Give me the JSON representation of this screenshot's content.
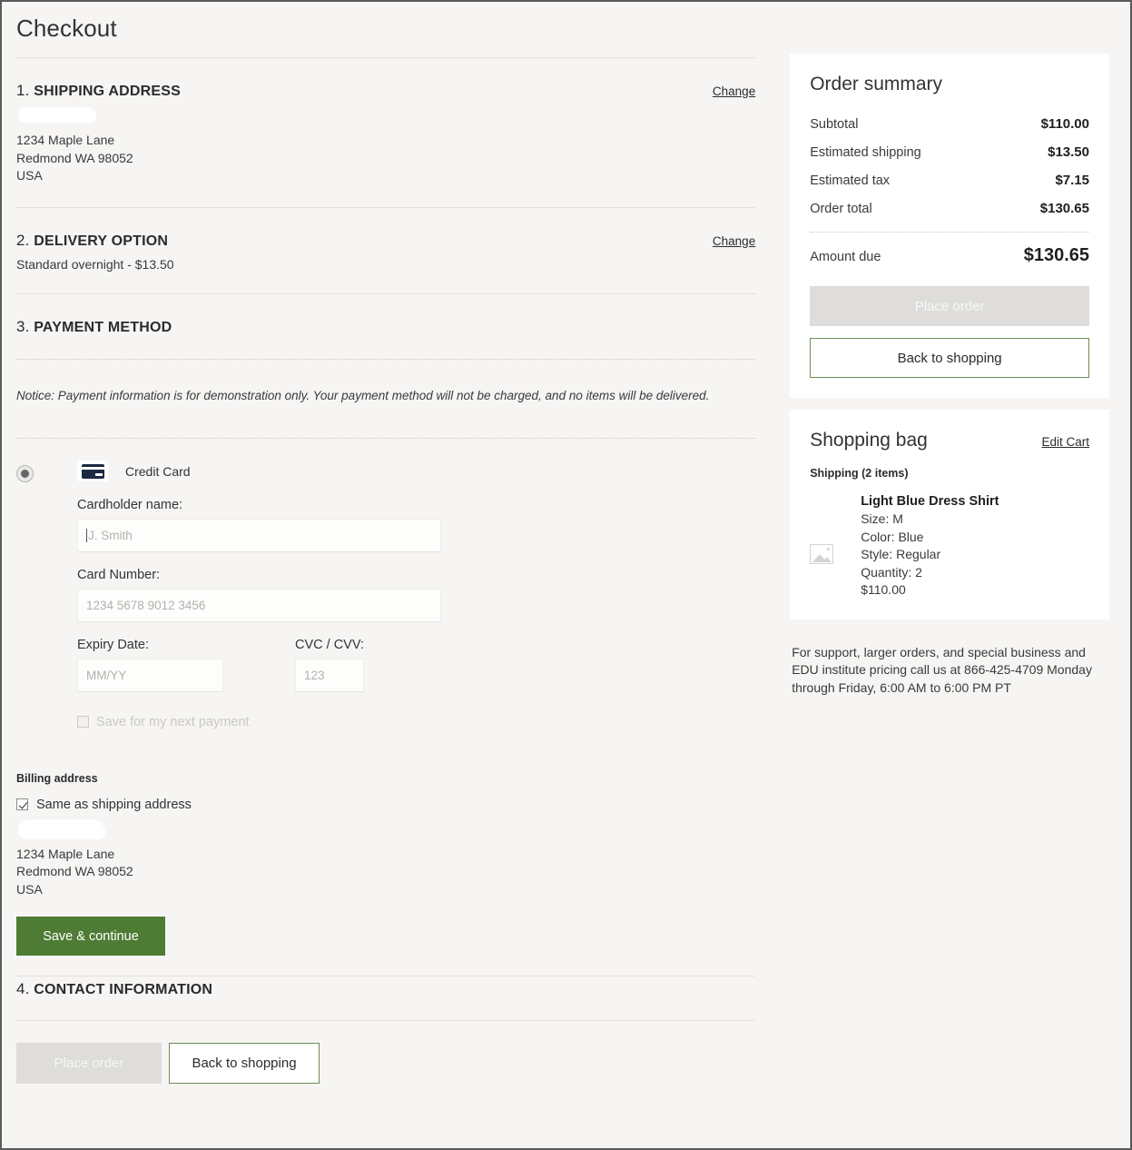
{
  "page": {
    "title": "Checkout"
  },
  "sections": {
    "shipping": {
      "number": "1.",
      "title": "SHIPPING ADDRESS",
      "change_label": "Change",
      "address_line1": "1234 Maple Lane",
      "address_line2": "Redmond WA 98052",
      "address_line3": "USA"
    },
    "delivery": {
      "number": "2.",
      "title": "DELIVERY OPTION",
      "change_label": "Change",
      "option": "Standard overnight -  $13.50"
    },
    "payment": {
      "number": "3.",
      "title": "PAYMENT METHOD",
      "notice": "Notice: Payment information is for demonstration only.  Your payment method will not be charged, and no items will be delivered.",
      "method_name": "Credit Card",
      "cardholder_label": "Cardholder name:",
      "cardholder_placeholder": "J. Smith",
      "cardholder_value": "",
      "cardnumber_label": "Card Number:",
      "cardnumber_placeholder": "1234 5678 9012 3456",
      "cardnumber_value": "",
      "expiry_label": "Expiry Date:",
      "expiry_placeholder": "MM/YY",
      "expiry_value": "",
      "cvc_label": "CVC / CVV:",
      "cvc_placeholder": "123",
      "cvc_value": "",
      "save_payment_label": "Save for my next payment",
      "billing_heading": "Billing address",
      "billing_same_label": "Same as shipping address",
      "billing_line1": "1234 Maple Lane",
      "billing_line2": "Redmond WA 98052",
      "billing_line3": "USA",
      "save_continue_label": "Save & continue"
    },
    "contact": {
      "number": "4.",
      "title": "CONTACT INFORMATION"
    }
  },
  "footer": {
    "place_order_label": "Place order",
    "back_to_shopping_label": "Back to shopping"
  },
  "order_summary": {
    "title": "Order summary",
    "rows": [
      {
        "label": "Subtotal",
        "value": "$110.00"
      },
      {
        "label": "Estimated shipping",
        "value": "$13.50"
      },
      {
        "label": "Estimated tax",
        "value": "$7.15"
      },
      {
        "label": "Order total",
        "value": "$130.65"
      }
    ],
    "amount_due_label": "Amount due",
    "amount_due_value": "$130.65",
    "place_order_label": "Place order",
    "back_to_shopping_label": "Back to shopping"
  },
  "shopping_bag": {
    "title": "Shopping bag",
    "edit_cart_label": "Edit Cart",
    "shipping_count_label": "Shipping (2 items)",
    "items": [
      {
        "name": "Light Blue Dress Shirt",
        "size": "Size: M",
        "color": "Color: Blue",
        "style": "Style: Regular",
        "quantity": "Quantity: 2",
        "price": "$110.00"
      }
    ],
    "support_text": "For support, larger orders, and special business and EDU institute pricing call us at 866-425-4709 Monday through Friday, 6:00 AM to 6:00 PM PT"
  },
  "colors": {
    "page_bg": "#f6f5f3",
    "card_bg": "#ffffff",
    "accent_green": "#4e7c35",
    "outline_green": "#6d8c56",
    "disabled_gray": "#dedddb"
  }
}
